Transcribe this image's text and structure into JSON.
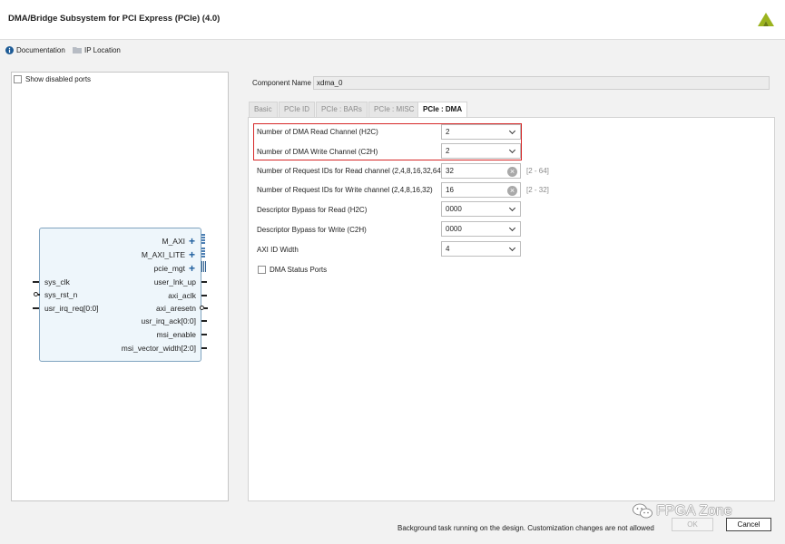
{
  "window": {
    "title": "DMA/Bridge Subsystem for PCI Express (PCIe) (4.0)"
  },
  "links": {
    "documentation": "Documentation",
    "ip_location": "IP Location"
  },
  "symbol": {
    "show_disabled_ports": "Show disabled ports",
    "right_pins": [
      "M_AXI",
      "M_AXI_LITE",
      "pcie_mgt",
      "user_lnk_up",
      "axi_aclk",
      "axi_aresetn",
      "usr_irq_ack[0:0]",
      "msi_enable",
      "msi_vector_width[2:0]"
    ],
    "left_pins": [
      "sys_clk",
      "sys_rst_n",
      "usr_irq_req[0:0]"
    ]
  },
  "component": {
    "label": "Component Name",
    "value": "xdma_0"
  },
  "tabs": [
    {
      "label": "Basic"
    },
    {
      "label": "PCIe ID"
    },
    {
      "label": "PCIe : BARs"
    },
    {
      "label": "PCIe : MISC"
    },
    {
      "label": "PCIe : DMA"
    }
  ],
  "params": {
    "read_channel_h2c": {
      "label": "Number of DMA Read Channel (H2C)",
      "value": "2"
    },
    "write_channel_c2h": {
      "label": "Number of DMA Write Channel (C2H)",
      "value": "2"
    },
    "req_ids_read": {
      "label": "Number of Request IDs for Read channel (2,4,8,16,32,64)",
      "value": "32",
      "range": "[2 - 64]"
    },
    "req_ids_write": {
      "label": "Number of Request IDs for Write channel (2,4,8,16,32)",
      "value": "16",
      "range": "[2 - 32]"
    },
    "desc_bypass_read": {
      "label": "Descriptor Bypass for Read (H2C)",
      "value": "0000"
    },
    "desc_bypass_write": {
      "label": "Descriptor Bypass for Write (C2H)",
      "value": "0000"
    },
    "axi_id_width": {
      "label": "AXI ID Width",
      "value": "4"
    },
    "dma_status_ports": {
      "label": "DMA Status Ports"
    }
  },
  "footer": {
    "status": "Background task running on the design. Customization changes are not allowed",
    "ok": "OK",
    "cancel": "Cancel"
  },
  "watermark": {
    "text": "FPGA Zone"
  },
  "colors": {
    "highlight": "#d62828",
    "block_fill": "#eef6fb",
    "logo": "#9bb31e"
  }
}
